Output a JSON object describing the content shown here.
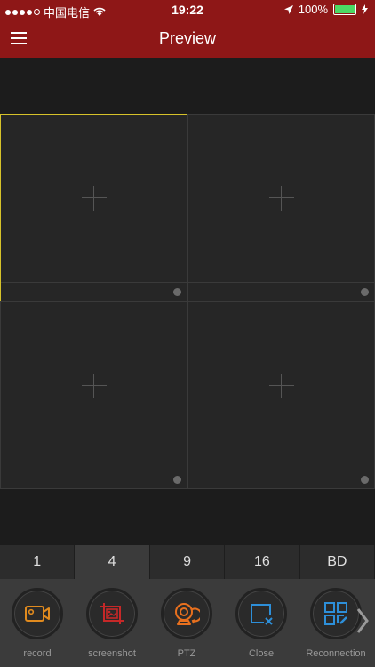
{
  "status_bar": {
    "carrier": "中国电信",
    "time": "19:22",
    "battery": "100%"
  },
  "header": {
    "title": "Preview"
  },
  "layout_options": [
    "1",
    "4",
    "9",
    "16",
    "BD"
  ],
  "selected_layout": "4",
  "toolbar": {
    "record_label": "record",
    "screenshot_label": "screenshot",
    "ptz_label": "PTZ",
    "close_label": "Close",
    "reconnection_label": "Reconnection"
  },
  "colors": {
    "header_bg": "#8e1717",
    "active_cell_border": "#d6c22a",
    "record_icon": "#e08a1e",
    "screenshot_icon": "#c62828",
    "ptz_icon": "#e8701e",
    "close_icon": "#2d8fd9",
    "reconnection_icon": "#2d8fd9"
  }
}
